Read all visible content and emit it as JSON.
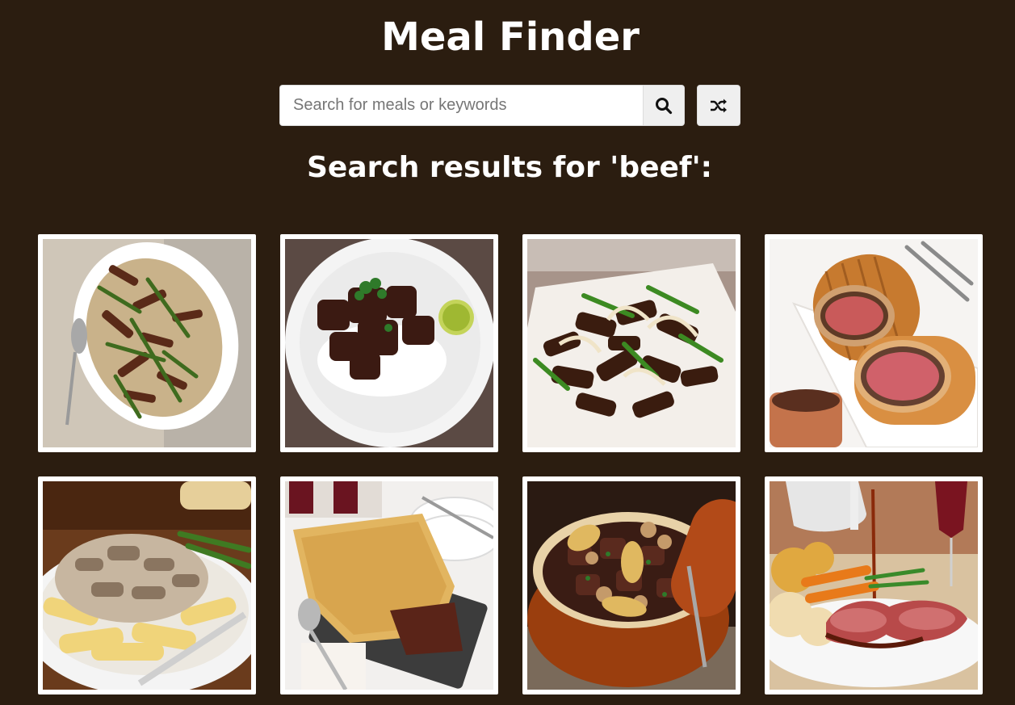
{
  "app": {
    "title": "Meal Finder"
  },
  "search": {
    "placeholder": "Search for meals or keywords",
    "value": "",
    "search_button_icon": "search-icon",
    "random_button_icon": "shuffle-icon"
  },
  "results": {
    "heading": "Search results for 'beef':"
  },
  "colors": {
    "background": "#2b1d10",
    "text": "#ffffff",
    "button_bg": "#efefef",
    "card_border": "#ffffff"
  }
}
